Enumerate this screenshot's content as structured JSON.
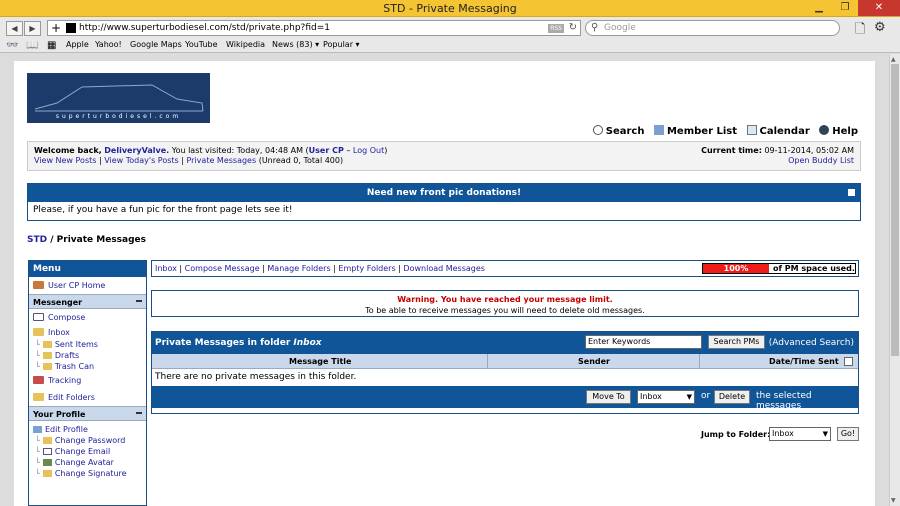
{
  "window": {
    "title": "STD - Private Messaging"
  },
  "browser": {
    "url": "http://www.superturbodiesel.com/std/private.php?fid=1",
    "rss_label": "RSS",
    "search_placeholder": "Google",
    "bookmarks": [
      "Apple",
      "Yahoo!",
      "Google Maps",
      "YouTube",
      "Wikipedia",
      "News (83) ▾",
      "Popular ▾"
    ]
  },
  "site": {
    "logo_text": "superturbodiesel.com"
  },
  "toplinks": {
    "search": "Search",
    "member_list": "Member List",
    "calendar": "Calendar",
    "help": "Help"
  },
  "welcome": {
    "prefix": "Welcome back,",
    "username": "DeliveryValve.",
    "last_visit": "You last visited: Today, 04:48 AM",
    "usercp_open": "(",
    "usercp": "User CP",
    "dash": " – ",
    "logout": "Log Out",
    "close_paren": ")",
    "view_new": "View New Posts",
    "view_today": "View Today's Posts",
    "private_messages": "Private Messages",
    "unread": "(Unread 0, Total 400)",
    "current_time_label": "Current time:",
    "current_time": "09-11-2014, 05:02 AM",
    "buddy_list": "Open Buddy List"
  },
  "notice": {
    "title": "Need new front pic donations!",
    "body": "Please, if you have a fun pic for the front page lets see it!"
  },
  "breadcrumb": {
    "root": "STD",
    "sep": " / ",
    "current": "Private Messages"
  },
  "sidebar": {
    "header": "Menu",
    "usercp_home": "User CP Home",
    "messenger": "Messenger",
    "compose": "Compose",
    "inbox": "Inbox",
    "sent": "Sent Items",
    "drafts": "Drafts",
    "trash": "Trash Can",
    "tracking": "Tracking",
    "edit_folders": "Edit Folders",
    "your_profile": "Your Profile",
    "edit_profile": "Edit Profile",
    "change_password": "Change Password",
    "change_email": "Change Email",
    "change_avatar": "Change Avatar",
    "change_signature": "Change Signature"
  },
  "links": {
    "inbox": "Inbox",
    "compose": "Compose Message",
    "manage": "Manage Folders",
    "empty": "Empty Folders",
    "download": "Download Messages",
    "sep": " | "
  },
  "quota": {
    "percent": "100%",
    "label": "of PM space used.",
    "fill": 1.0
  },
  "warning": {
    "title": "Warning. You have reached your message limit.",
    "body": "To be able to receive messages you will need to delete old messages."
  },
  "pm": {
    "header_prefix": "Private Messages in folder",
    "folder": "Inbox",
    "keywords_value": "Enter Keywords",
    "search_button": "Search PMs",
    "advanced": "(Advanced Search)",
    "col_title": "Message Title",
    "col_sender": "Sender",
    "col_date": "Date/Time Sent",
    "empty": "There are no private messages in this folder.",
    "move_to": "Move To",
    "folder_select": "Inbox",
    "or": "or",
    "delete": "Delete",
    "selected": "the selected messages"
  },
  "jump": {
    "label": "Jump to Folder:",
    "value": "Inbox",
    "go": "Go!"
  }
}
